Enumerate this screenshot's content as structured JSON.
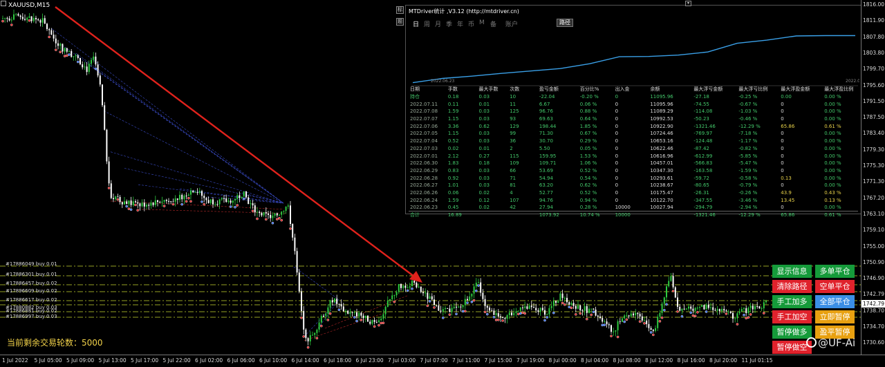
{
  "symbol": "XAUUSD,M15",
  "panel": {
    "title": "MTDriver统计 ,V3.12 (http://mtdriver.cn)",
    "tabs": [
      "年",
      "日",
      "周",
      "月",
      "季",
      "年",
      "币",
      "M",
      "备",
      "账户"
    ],
    "active_tab": 1,
    "path_button": "路径",
    "side_buttons": [
      "标",
      "题"
    ],
    "eq_start_label": "2022.06.23",
    "eq_end_label": "2022.0",
    "eq_values": [
      10027.94,
      10122.7,
      10175.47,
      10238.67,
      10293.61,
      10347.3,
      10457.01,
      10616.96,
      10622.46,
      10653.16,
      10724.46,
      10922.9,
      10992.53,
      11089.29,
      11095.96,
      11095.96
    ],
    "headers": [
      "日期",
      "手数",
      "最大手数",
      "次数",
      "盈亏金额",
      "百分比%",
      "出入金",
      "余额",
      "最大浮亏金额",
      "最大浮亏比例",
      "最大浮盈金额",
      "最大浮盈比例"
    ],
    "rows": [
      [
        "持仓",
        "0.18",
        "0.03",
        "10",
        "-22.04",
        "-0.20 %",
        "0",
        "11095.96",
        "-27.18",
        "-0.25 %",
        "0.00",
        "0.00 %"
      ],
      [
        "2022.07.11",
        "0.11",
        "0.01",
        "11",
        "6.67",
        "0.06 %",
        "0",
        "11095.96",
        "-74.55",
        "-0.67 %",
        "0",
        "0.00 %"
      ],
      [
        "2022.07.08",
        "1.59",
        "0.03",
        "125",
        "96.76",
        "0.88 %",
        "0",
        "11089.29",
        "-114.08",
        "-1.03 %",
        "0",
        "0.00 %"
      ],
      [
        "2022.07.07",
        "1.15",
        "0.03",
        "93",
        "69.63",
        "0.64 %",
        "0",
        "10992.53",
        "-50.23",
        "-0.46 %",
        "0",
        "0.00 %"
      ],
      [
        "2022.07.06",
        "3.36",
        "0.62",
        "129",
        "198.44",
        "1.85 %",
        "0",
        "10922.90",
        "-1321.46",
        "-12.29 %",
        "65.86",
        "0.61 %"
      ],
      [
        "2022.07.05",
        "1.15",
        "0.03",
        "99",
        "71.30",
        "0.67 %",
        "0",
        "10724.46",
        "-769.97",
        "-7.18 %",
        "0",
        "0.00 %"
      ],
      [
        "2022.07.04",
        "0.52",
        "0.03",
        "36",
        "30.70",
        "0.29 %",
        "0",
        "10653.16",
        "-124.48",
        "-1.17 %",
        "0",
        "0.00 %"
      ],
      [
        "2022.07.03",
        "0.02",
        "0.01",
        "2",
        "5.50",
        "0.05 %",
        "0",
        "10622.46",
        "-87.42",
        "-0.82 %",
        "0",
        "0.00 %"
      ],
      [
        "2022.07.01",
        "2.12",
        "0.27",
        "115",
        "159.95",
        "1.53 %",
        "0",
        "10616.96",
        "-612.99",
        "-5.85 %",
        "0",
        "0.00 %"
      ],
      [
        "2022.06.30",
        "1.83",
        "0.18",
        "109",
        "109.71",
        "1.06 %",
        "0",
        "10457.01",
        "-566.83",
        "-5.47 %",
        "0",
        "0.00 %"
      ],
      [
        "2022.06.29",
        "0.83",
        "0.03",
        "66",
        "53.69",
        "0.52 %",
        "0",
        "10347.30",
        "-163.58",
        "-1.59 %",
        "0",
        "0.00 %"
      ],
      [
        "2022.06.28",
        "0.92",
        "0.03",
        "71",
        "54.94",
        "0.54 %",
        "0",
        "10293.61",
        "-59.72",
        "-0.58 %",
        "0.13",
        "0.00 %"
      ],
      [
        "2022.06.27",
        "1.01",
        "0.03",
        "81",
        "63.20",
        "0.62 %",
        "0",
        "10238.67",
        "-80.65",
        "-0.79 %",
        "0",
        "0.00 %"
      ],
      [
        "2022.06.26",
        "0.06",
        "0.02",
        "4",
        "52.77",
        "0.52 %",
        "0",
        "10175.47",
        "-26.31",
        "-0.26 %",
        "43.9",
        "0.43 %"
      ],
      [
        "2022.06.24",
        "1.59",
        "0.12",
        "107",
        "94.76",
        "0.94 %",
        "0",
        "10122.70",
        "-347.55",
        "-3.46 %",
        "13.45",
        "0.13 %"
      ],
      [
        "2022.06.23",
        "0.45",
        "0.02",
        "42",
        "27.94",
        "0.28 %",
        "10000",
        "10027.94",
        "-294.79",
        "-2.94 %",
        "0",
        "0.00 %"
      ]
    ],
    "total": [
      "合计",
      "16.89",
      "",
      "",
      "1073.92",
      "10.74 %",
      "10000",
      "",
      "-1321.46",
      "-12.29 %",
      "65.86",
      "0.61 %"
    ]
  },
  "orders": [
    "#17886049 buy 0.01",
    "#17886301 buy 0.01",
    "#17886457 buy 0.02",
    "#17896609 buy 0.02",
    "#17886617 buy 0.02",
    "#17880882 buy 0.03",
    "#17886881 buy 0.02",
    "#17886997 buy 0.03"
  ],
  "rounds_label": "当前剩余交易轮数：5000",
  "price_axis": [
    "1816.00",
    "1811.90",
    "1807.80",
    "1803.80",
    "1799.70",
    "1795.60",
    "1791.50",
    "1787.50",
    "1783.40",
    "1779.30",
    "1775.30",
    "1771.30",
    "1767.20",
    "1763.10",
    "1759.10",
    "1755.00",
    "1750.90",
    "1746.90",
    "1742.79",
    "1738.70",
    "1734.70",
    "1730.60"
  ],
  "current_price": "1742.79",
  "time_axis": [
    "1 Jul 2022",
    "5 Jul 05:00",
    "5 Jul 09:00",
    "5 Jul 13:00",
    "5 Jul 17:00",
    "5 Jul 22:00",
    "6 Jul 02:00",
    "6 Jul 06:00",
    "6 Jul 10:00",
    "6 Jul 14:00",
    "6 Jul 18:00",
    "6 Jul 23:00",
    "7 Jul 03:00",
    "7 Jul 07:00",
    "7 Jul 11:00",
    "7 Jul 15:00",
    "7 Jul 19:00",
    "8 Jul 00:00",
    "8 Jul 04:00",
    "8 Jul 08:00",
    "8 Jul 12:00",
    "8 Jul 16:00",
    "8 Jul 20:00",
    "11 Jul 01:15"
  ],
  "buttons": [
    {
      "label": "显示信息",
      "color": "#159b3a"
    },
    {
      "label": "多单平仓",
      "color": "#159b3a"
    },
    {
      "label": "清除路径",
      "color": "#e0222c"
    },
    {
      "label": "空单平仓",
      "color": "#e0222c"
    },
    {
      "label": "手工加多",
      "color": "#159b3a"
    },
    {
      "label": "全部平仓",
      "color": "#3b8ee5"
    },
    {
      "label": "手工加空",
      "color": "#e0222c"
    },
    {
      "label": "立即暂停",
      "color": "#e8a010"
    },
    {
      "label": "暂停做多",
      "color": "#159b3a"
    },
    {
      "label": "盈平暂停",
      "color": "#e8a010"
    },
    {
      "label": "暂停做空",
      "color": "#e0222c"
    }
  ],
  "watermark": "@UF-Ai",
  "colors": {
    "bull": "#2ecc40",
    "bear": "#ffffff",
    "trend_arrow": "#e0221c",
    "level_line": "#c8d830"
  }
}
